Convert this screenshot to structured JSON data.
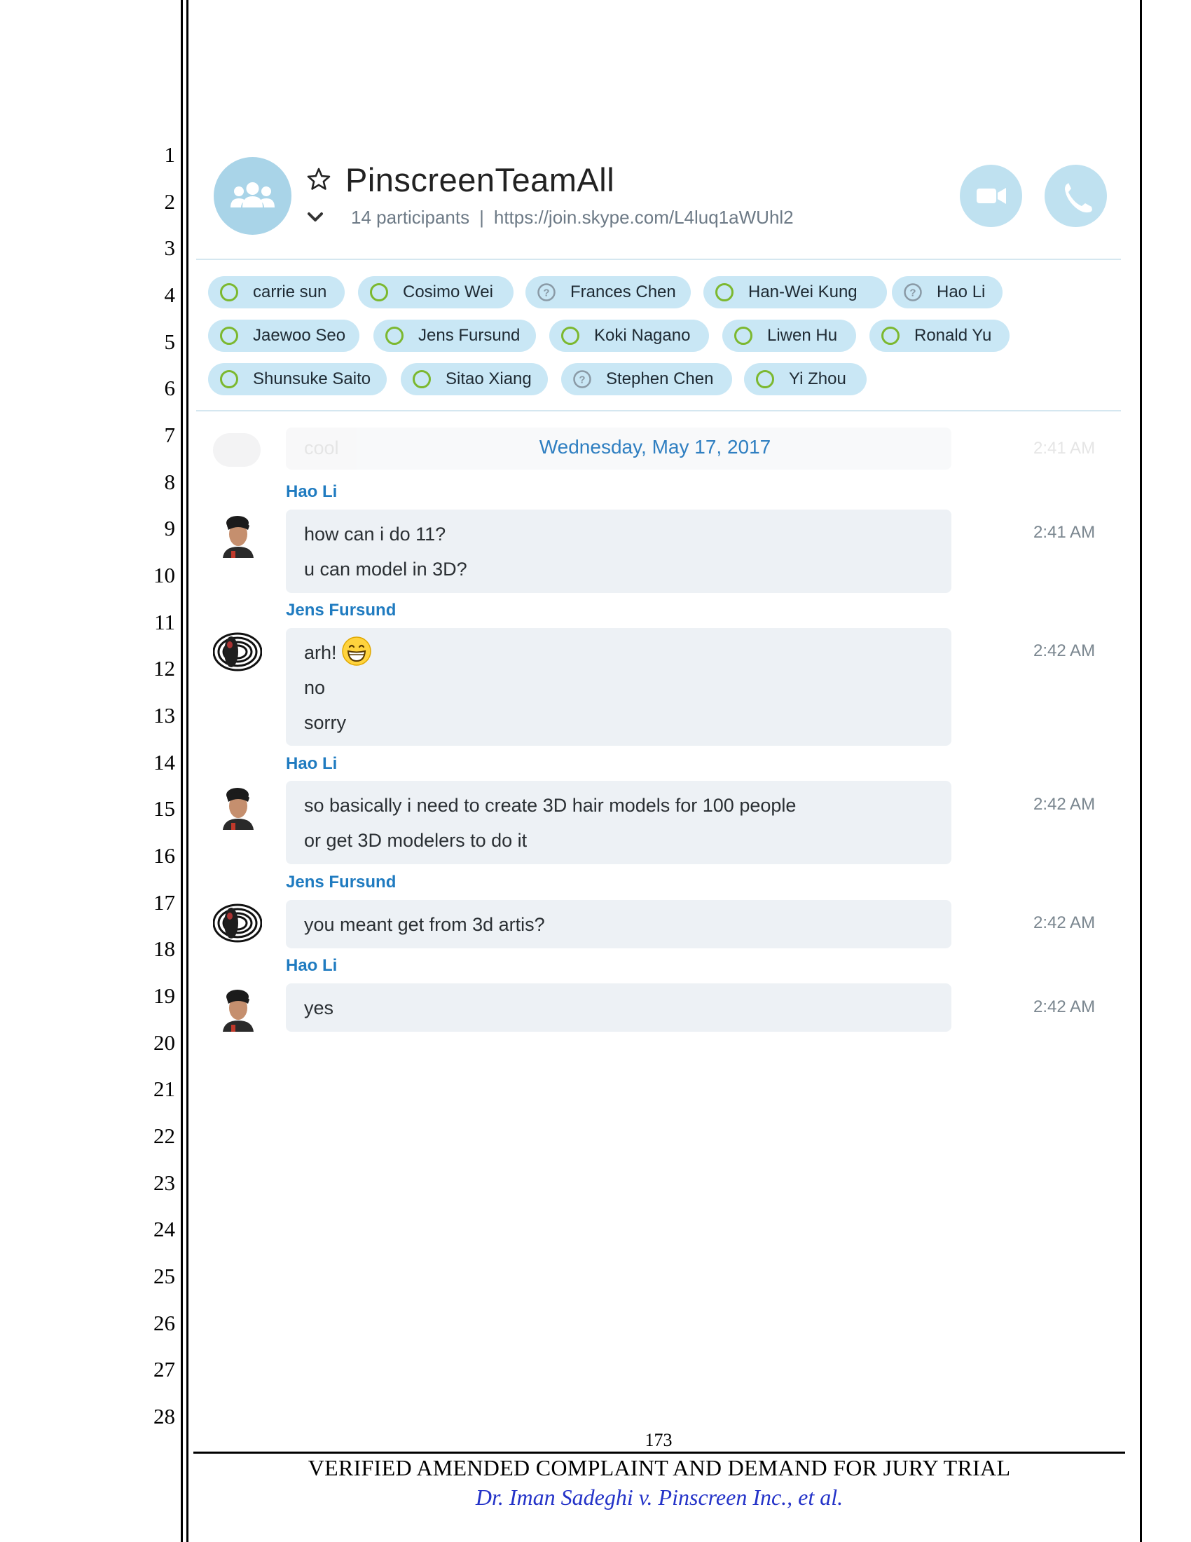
{
  "line_numbers": [
    "1",
    "2",
    "3",
    "4",
    "5",
    "6",
    "7",
    "8",
    "9",
    "10",
    "11",
    "12",
    "13",
    "14",
    "15",
    "16",
    "17",
    "18",
    "19",
    "20",
    "21",
    "22",
    "23",
    "24",
    "25",
    "26",
    "27",
    "28"
  ],
  "chat": {
    "title": "PinscreenTeamAll",
    "participants_count": "14 participants",
    "separator": "|",
    "join_link": "https://join.skype.com/L4luq1aWUhl2",
    "icons": {
      "group": "group-avatar-icon",
      "favorite": "star-icon",
      "expand": "chevron-down-icon",
      "video": "video-call-icon",
      "call": "phone-call-icon"
    },
    "colors": {
      "accent": "#1f7bc0",
      "chip_bg": "#c9e7f5",
      "online": "#7cb82f",
      "unknown": "#8a9aa6",
      "bubble": "#edf1f5"
    }
  },
  "participants": [
    {
      "name": "carrie sun",
      "status": "online"
    },
    {
      "name": "Cosimo Wei",
      "status": "online"
    },
    {
      "name": "Frances Chen",
      "status": "unknown"
    },
    {
      "name": "Han-Wei Kung",
      "status": "online"
    },
    {
      "name": "Hao Li",
      "status": "unknown"
    },
    {
      "name": "Jaewoo Seo",
      "status": "online"
    },
    {
      "name": "Jens Fursund",
      "status": "online"
    },
    {
      "name": "Koki Nagano",
      "status": "online"
    },
    {
      "name": "Liwen Hu",
      "status": "online"
    },
    {
      "name": "Ronald Yu",
      "status": "online"
    },
    {
      "name": "Shunsuke Saito",
      "status": "online"
    },
    {
      "name": "Sitao Xiang",
      "status": "online"
    },
    {
      "name": "Stephen Chen",
      "status": "unknown"
    },
    {
      "name": "Yi Zhou",
      "status": "online"
    }
  ],
  "faded_message": {
    "text": "cool",
    "time": "2:41 AM"
  },
  "date_separator": "Wednesday, May 17, 2017",
  "messages": [
    {
      "sender": "Hao Li",
      "time": "2:41 AM",
      "lines": [
        "how can i do 11?",
        "u can model in 3D?"
      ]
    },
    {
      "sender": "Jens Fursund",
      "time": "2:42 AM",
      "lines": [
        "arh!",
        "no",
        "sorry"
      ],
      "emoji": "grinning-emoji-icon"
    },
    {
      "sender": "Hao Li",
      "time": "2:42 AM",
      "lines": [
        "so basically i need to create 3D hair models for 100 people",
        "or get 3D modelers to do it"
      ]
    },
    {
      "sender": "Jens Fursund",
      "time": "2:42 AM",
      "lines": [
        "you meant get from 3d artis?"
      ]
    },
    {
      "sender": "Hao Li",
      "time": "2:42 AM",
      "lines": [
        "yes"
      ]
    }
  ],
  "footer": {
    "page_number": "173",
    "title": "VERIFIED AMENDED COMPLAINT AND DEMAND FOR JURY TRIAL",
    "case": "Dr. Iman Sadeghi v. Pinscreen Inc., et al."
  }
}
